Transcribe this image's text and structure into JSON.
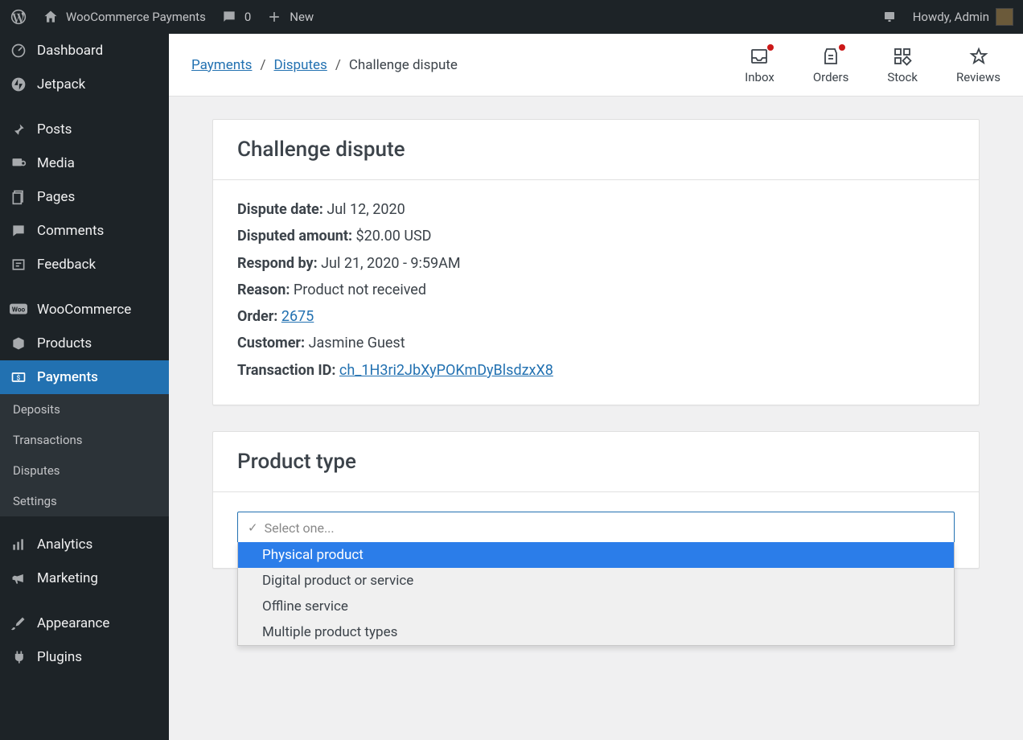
{
  "adminbar": {
    "site_name": "WooCommerce Payments",
    "comment_count": "0",
    "new_label": "New",
    "greeting": "Howdy, Admin"
  },
  "sidebar": {
    "items": [
      {
        "label": "Dashboard",
        "icon": "dashboard"
      },
      {
        "label": "Jetpack",
        "icon": "jetpack"
      },
      {
        "label": "Posts",
        "icon": "pin"
      },
      {
        "label": "Media",
        "icon": "media"
      },
      {
        "label": "Pages",
        "icon": "pages"
      },
      {
        "label": "Comments",
        "icon": "comment"
      },
      {
        "label": "Feedback",
        "icon": "feedback"
      },
      {
        "label": "WooCommerce",
        "icon": "woo"
      },
      {
        "label": "Products",
        "icon": "products"
      },
      {
        "label": "Payments",
        "icon": "payments",
        "current": true
      },
      {
        "label": "Analytics",
        "icon": "analytics"
      },
      {
        "label": "Marketing",
        "icon": "marketing"
      },
      {
        "label": "Appearance",
        "icon": "appearance"
      },
      {
        "label": "Plugins",
        "icon": "plugins"
      }
    ],
    "submenu": [
      "Deposits",
      "Transactions",
      "Disputes",
      "Settings"
    ]
  },
  "header": {
    "breadcrumbs": {
      "root": "Payments",
      "parent": "Disputes",
      "current": "Challenge dispute"
    },
    "tabs": [
      {
        "label": "Inbox",
        "dot": true
      },
      {
        "label": "Orders",
        "dot": true
      },
      {
        "label": "Stock",
        "dot": false
      },
      {
        "label": "Reviews",
        "dot": false
      }
    ]
  },
  "dispute_card": {
    "title": "Challenge dispute",
    "rows": {
      "date_label": "Dispute date:",
      "date_value": "Jul 12, 2020",
      "amount_label": "Disputed amount:",
      "amount_value": "$20.00 USD",
      "respond_label": "Respond by:",
      "respond_value": "Jul 21, 2020 - 9:59AM",
      "reason_label": "Reason:",
      "reason_value": "Product not received",
      "order_label": "Order:",
      "order_value": "2675",
      "customer_label": "Customer:",
      "customer_value": "Jasmine Guest",
      "txn_label": "Transaction ID:",
      "txn_value": "ch_1H3ri2JbXyPOKmDyBlsdzxX8"
    }
  },
  "product_type_card": {
    "title": "Product type",
    "placeholder": "Select one...",
    "options": [
      "Physical product",
      "Digital product or service",
      "Offline service",
      "Multiple product types"
    ],
    "highlighted_index": 0
  }
}
